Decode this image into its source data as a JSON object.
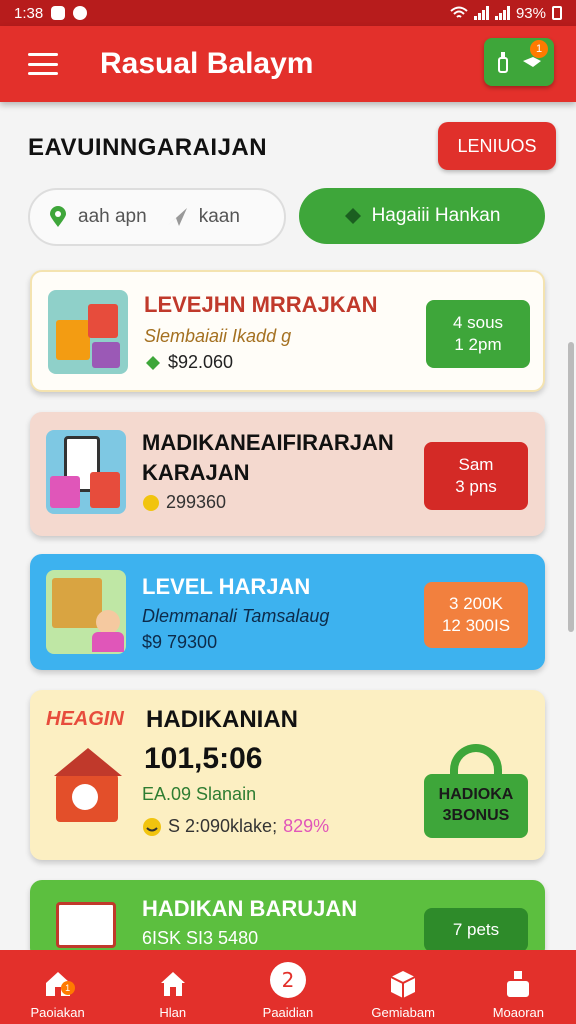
{
  "status": {
    "time": "1:38",
    "battery": "93%"
  },
  "header": {
    "title": "Rasual Balaym",
    "cart_count": "1"
  },
  "section": {
    "title": "EAVUINNGARAIJAN",
    "more_label": "LENIUOS"
  },
  "search": {
    "text1": "aah apn",
    "text2": "kaan"
  },
  "filter": {
    "label": "Hagaiii Hankan"
  },
  "cards": [
    {
      "title": "LEVEJHN MRRAJKAN",
      "subtitle": "Slembaiaii Ikadd g",
      "price": "$92.060",
      "badge_line1": "4 sous",
      "badge_line2": "1 2pm"
    },
    {
      "title_line1": "MADIKANEAIFIRARJAN",
      "title_line2": "KARAJAN",
      "price": "299360",
      "badge_line1": "Sam",
      "badge_line2": "3 pns"
    },
    {
      "title": "LEVEL HARJAN",
      "subtitle": "Dlemmanali Tamsalaug",
      "price": "$9 79300",
      "badge_line1": "3 200K",
      "badge_line2": "12 300IS"
    },
    {
      "tag": "HEAGIN",
      "title": "HADIKANIAN",
      "timer": "101,5:06",
      "subtitle": "EA.09 Slanain",
      "price": "S 2:090klake;",
      "price_extra": "829%",
      "badge_line1": "HADIOKA",
      "badge_line2": "3BONUS"
    },
    {
      "title": "HADIKAN BARUJAN",
      "subtitle": "6ISK SI3 5480",
      "badge_line1": "7 pets"
    }
  ],
  "nav": [
    {
      "label": "Paoiakan",
      "icon": "home-icon",
      "badge": "1"
    },
    {
      "label": "Hlan",
      "icon": "house-icon"
    },
    {
      "label": "Paaidian",
      "icon": "gift-icon"
    },
    {
      "label": "Gemiabam",
      "icon": "box-icon"
    },
    {
      "label": "Moaoran",
      "icon": "profile-icon"
    }
  ],
  "colors": {
    "primary": "#e3302b",
    "accent_green": "#3ea63a",
    "orange": "#f2803e",
    "blue": "#3db2ef",
    "peach": "#f4d9cf",
    "cream": "#fcefc2"
  }
}
